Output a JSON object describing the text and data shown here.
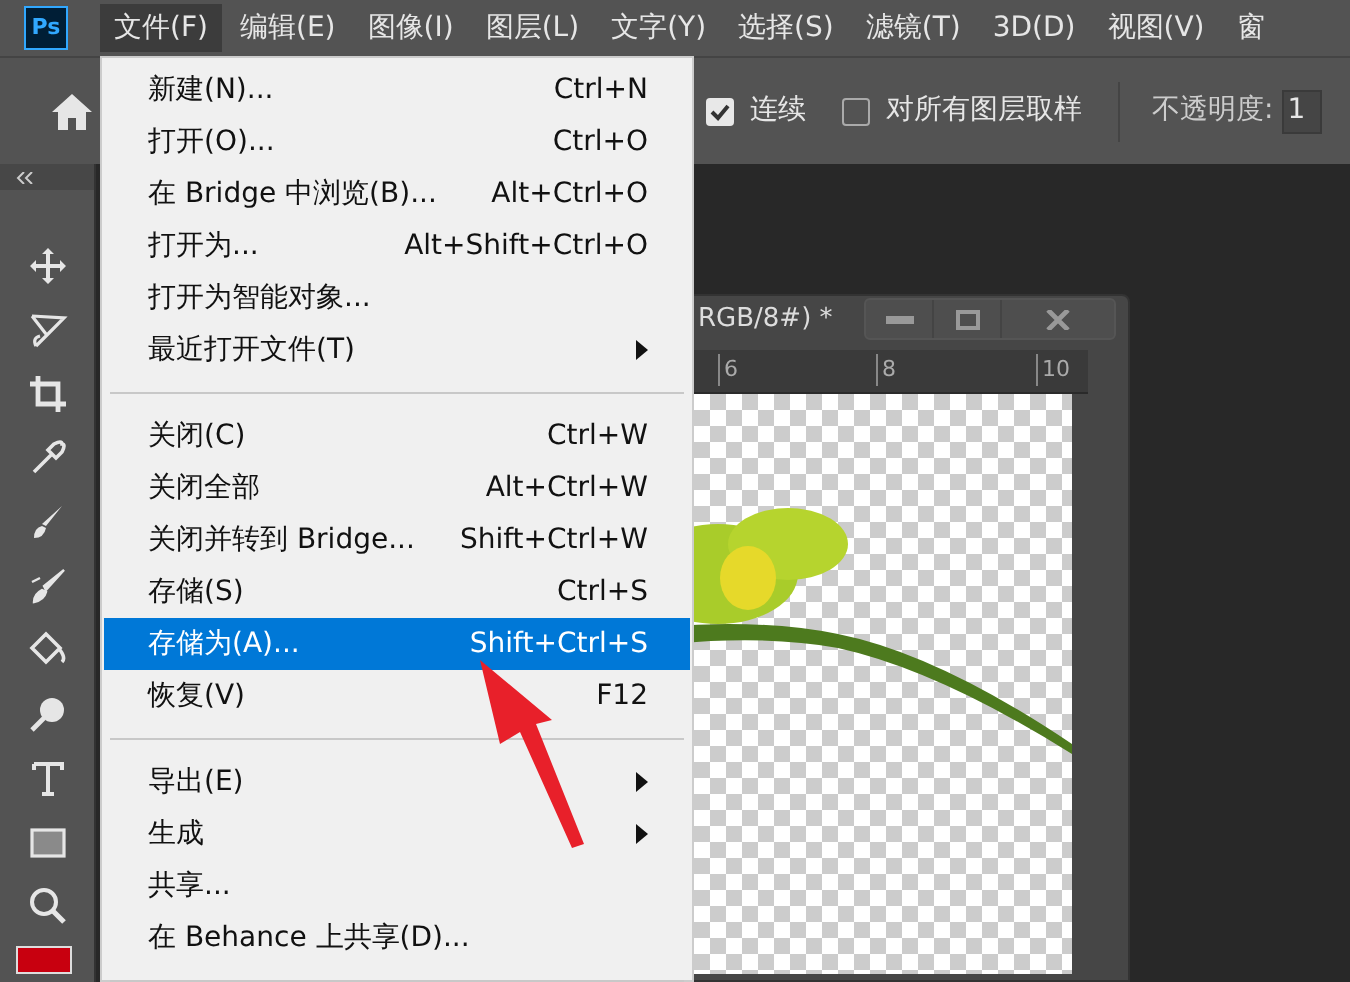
{
  "menubar": {
    "logo": "Ps",
    "items": [
      {
        "label": "文件(F)",
        "selected": true
      },
      {
        "label": "编辑(E)",
        "selected": false
      },
      {
        "label": "图像(I)",
        "selected": false
      },
      {
        "label": "图层(L)",
        "selected": false
      },
      {
        "label": "文字(Y)",
        "selected": false
      },
      {
        "label": "选择(S)",
        "selected": false
      },
      {
        "label": "滤镜(T)",
        "selected": false
      },
      {
        "label": "3D(D)",
        "selected": false
      },
      {
        "label": "视图(V)",
        "selected": false
      },
      {
        "label": "窗",
        "selected": false
      }
    ]
  },
  "options_bar": {
    "checkboxes": [
      {
        "label": "连续",
        "checked": true
      },
      {
        "label": "对所有图层取样",
        "checked": false
      }
    ],
    "opacity_label": "不透明度:",
    "opacity_value": "1"
  },
  "document": {
    "title": "RGB/8#) *",
    "ruler_labels": [
      "6",
      "8",
      "10"
    ]
  },
  "file_menu": {
    "items": [
      {
        "kind": "item",
        "label": "新建(N)...",
        "shortcut": "Ctrl+N",
        "selected": false
      },
      {
        "kind": "item",
        "label": "打开(O)...",
        "shortcut": "Ctrl+O",
        "selected": false
      },
      {
        "kind": "item",
        "label": "在 Bridge 中浏览(B)...",
        "shortcut": "Alt+Ctrl+O",
        "selected": false
      },
      {
        "kind": "item",
        "label": "打开为...",
        "shortcut": "Alt+Shift+Ctrl+O",
        "selected": false
      },
      {
        "kind": "item",
        "label": "打开为智能对象...",
        "selected": false
      },
      {
        "kind": "submenu",
        "label": "最近打开文件(T)",
        "selected": false
      },
      {
        "kind": "separator"
      },
      {
        "kind": "item",
        "label": "关闭(C)",
        "shortcut": "Ctrl+W",
        "selected": false
      },
      {
        "kind": "item",
        "label": "关闭全部",
        "shortcut": "Alt+Ctrl+W",
        "selected": false
      },
      {
        "kind": "item",
        "label": "关闭并转到 Bridge...",
        "shortcut": "Shift+Ctrl+W",
        "selected": false
      },
      {
        "kind": "item",
        "label": "存储(S)",
        "shortcut": "Ctrl+S",
        "selected": false
      },
      {
        "kind": "item",
        "label": "存储为(A)...",
        "shortcut": "Shift+Ctrl+S",
        "selected": true
      },
      {
        "kind": "item",
        "label": "恢复(V)",
        "shortcut": "F12",
        "selected": false
      },
      {
        "kind": "separator"
      },
      {
        "kind": "submenu",
        "label": "导出(E)",
        "selected": false
      },
      {
        "kind": "submenu",
        "label": "生成",
        "selected": false
      },
      {
        "kind": "item",
        "label": "共享...",
        "selected": false
      },
      {
        "kind": "item",
        "label": "在 Behance 上共享(D)...",
        "selected": false
      },
      {
        "kind": "separator"
      }
    ]
  }
}
